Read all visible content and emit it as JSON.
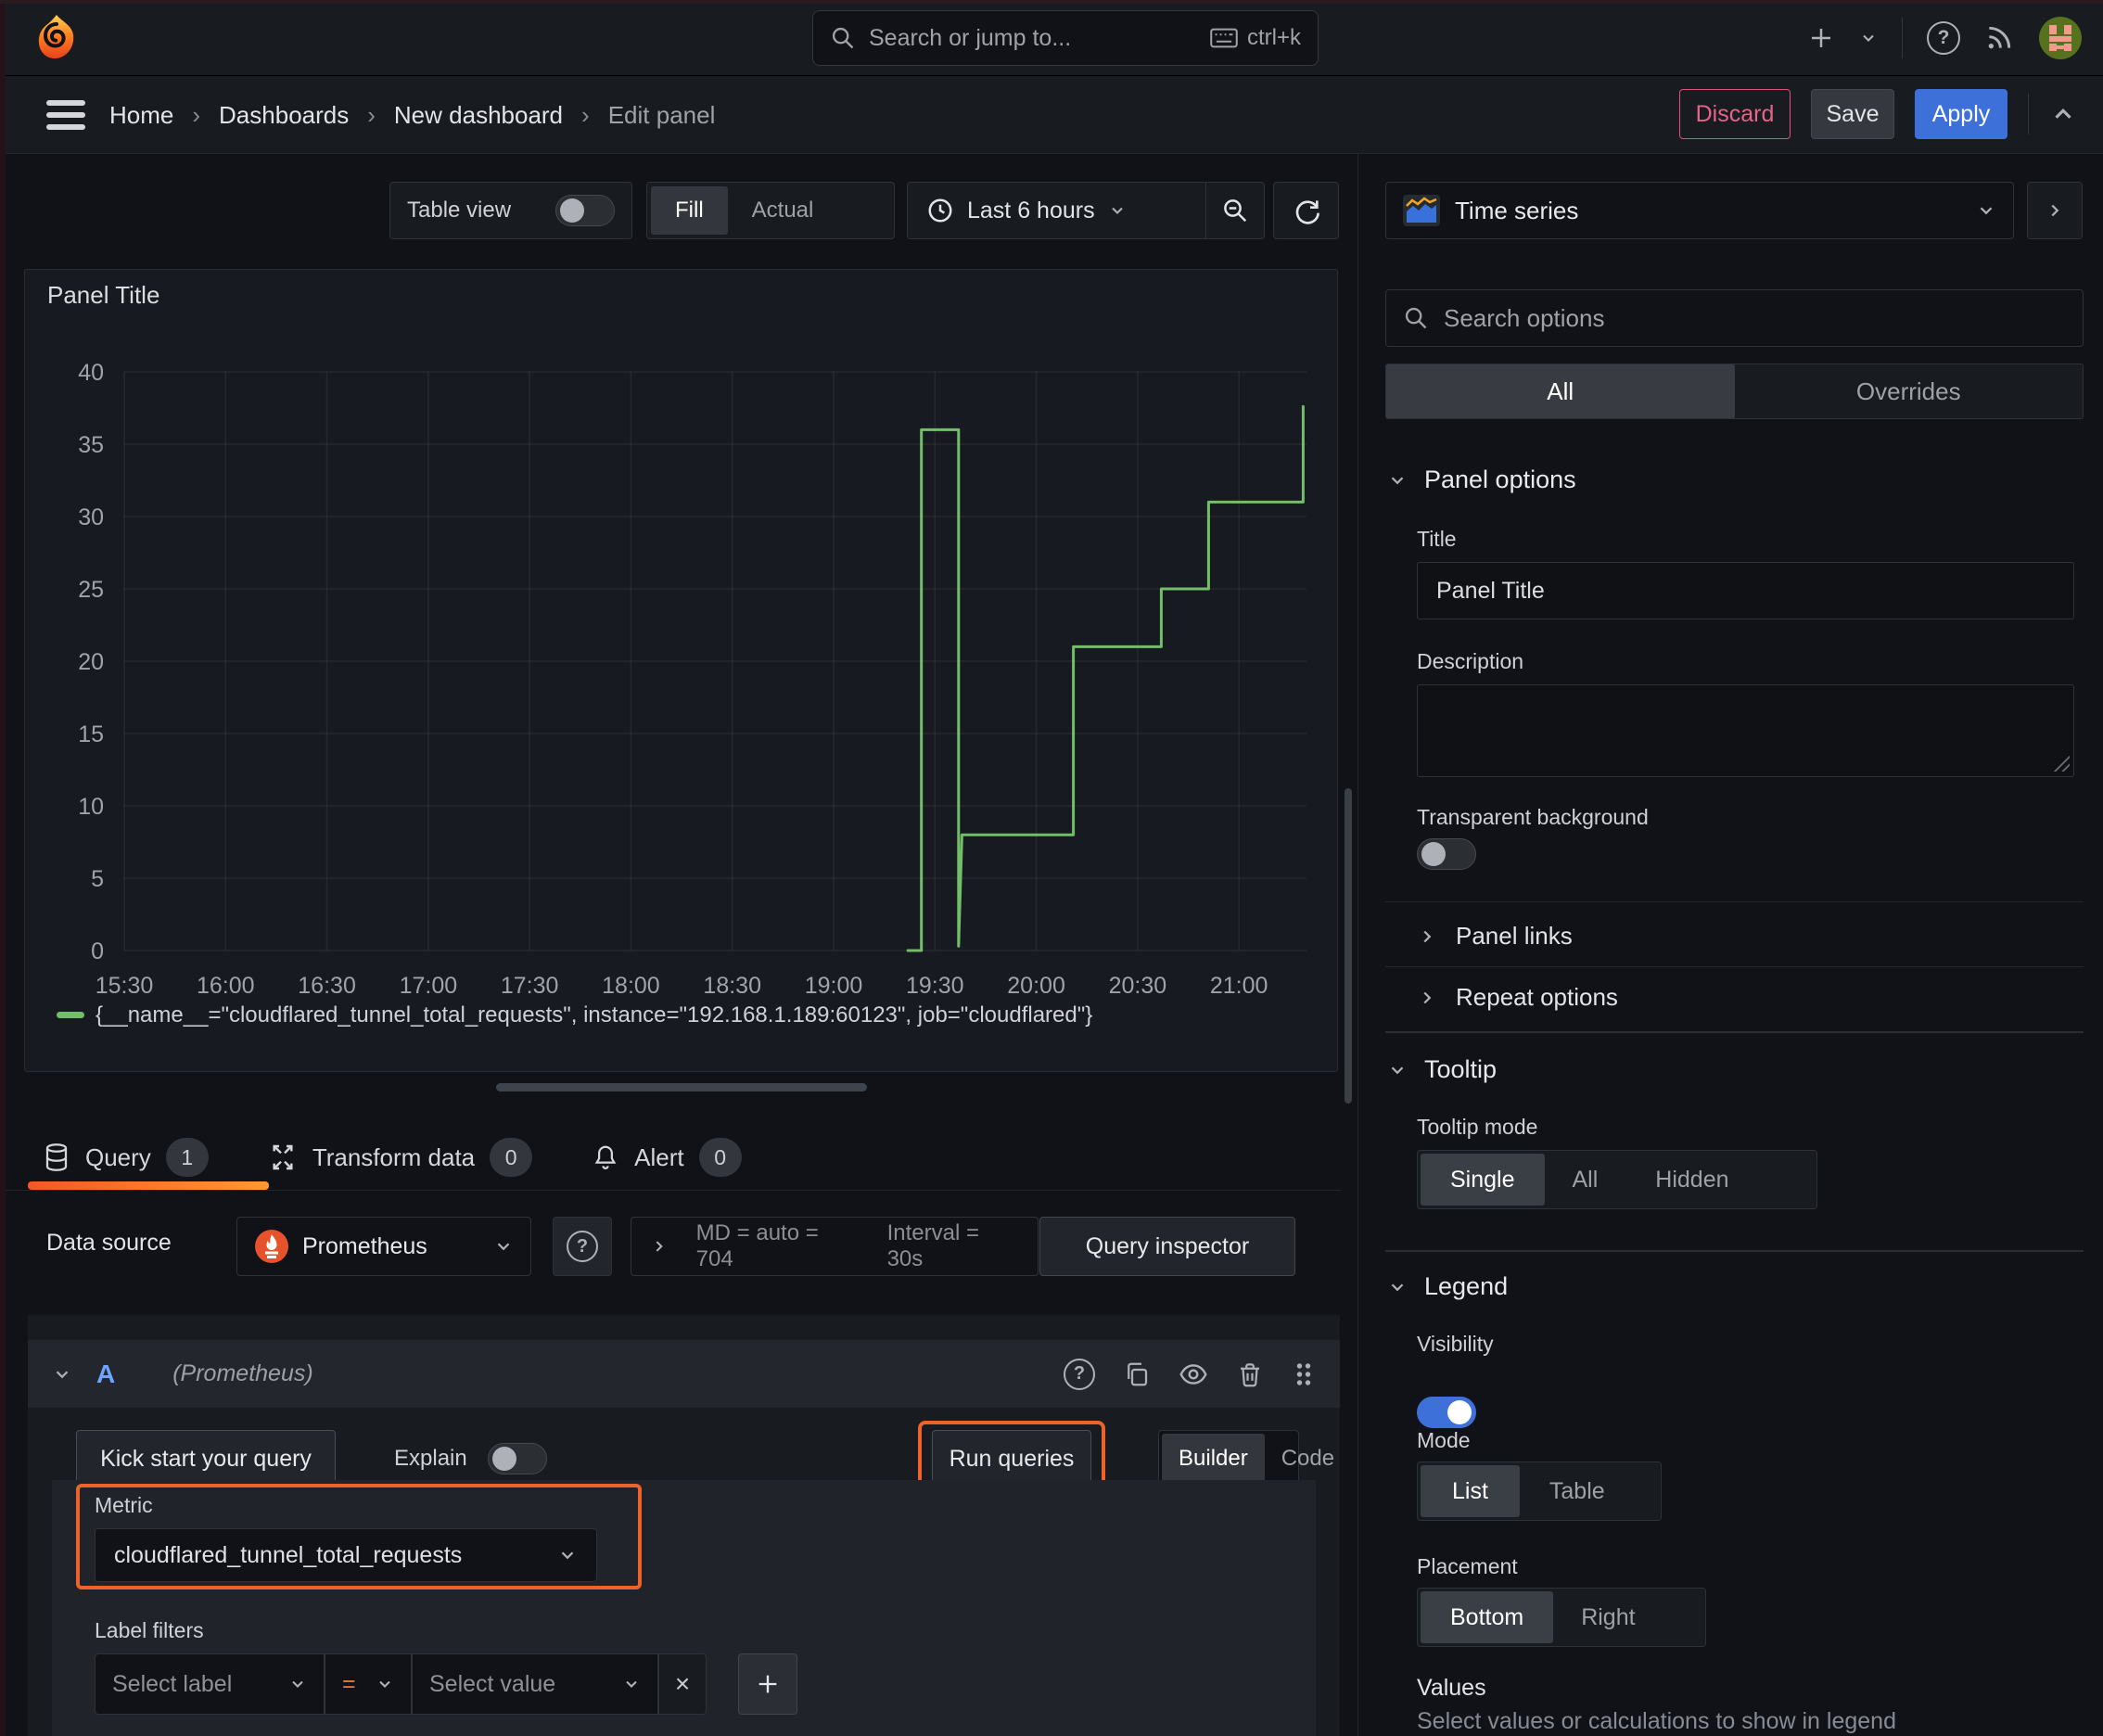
{
  "topnav": {
    "search_placeholder": "Search or jump to...",
    "search_shortcut": "ctrl+k"
  },
  "breadcrumbs": {
    "items": [
      "Home",
      "Dashboards",
      "New dashboard",
      "Edit panel"
    ],
    "separator": "›"
  },
  "header_actions": {
    "discard": "Discard",
    "save": "Save",
    "apply": "Apply"
  },
  "toolbar": {
    "table_view_label": "Table view",
    "view_modes": [
      "Fill",
      "Actual"
    ],
    "time_range_label": "Last 6 hours"
  },
  "panel": {
    "title": "Panel Title"
  },
  "chart_data": {
    "type": "line",
    "title": "Panel Title",
    "x_ticks": [
      "15:30",
      "16:00",
      "16:30",
      "17:00",
      "17:30",
      "18:00",
      "18:30",
      "19:00",
      "19:30",
      "20:00",
      "20:30",
      "21:00"
    ],
    "x_tick_minutes": [
      0,
      30,
      60,
      90,
      120,
      150,
      180,
      210,
      240,
      270,
      300,
      330
    ],
    "x_range_minutes": [
      0,
      350
    ],
    "y_ticks": [
      0,
      5,
      10,
      15,
      20,
      25,
      30,
      35,
      40
    ],
    "ylim": [
      0,
      40
    ],
    "grid": true,
    "legend_position": "bottom",
    "series": [
      {
        "name": "{__name__=\"cloudflared_tunnel_total_requests\", instance=\"192.168.1.189:60123\", job=\"cloudflared\"}",
        "color": "#73BF69",
        "points": [
          [
            232,
            0
          ],
          [
            236,
            0
          ],
          [
            236,
            36
          ],
          [
            247,
            36
          ],
          [
            247,
            0.3
          ],
          [
            248,
            8
          ],
          [
            281,
            8
          ],
          [
            281,
            21
          ],
          [
            307,
            21
          ],
          [
            307,
            25
          ],
          [
            321,
            25
          ],
          [
            321,
            31
          ],
          [
            349,
            31
          ],
          [
            349,
            37.6
          ]
        ]
      }
    ]
  },
  "editor_tabs": [
    {
      "label": "Query",
      "badge": "1"
    },
    {
      "label": "Transform data",
      "badge": "0"
    },
    {
      "label": "Alert",
      "badge": "0"
    }
  ],
  "query_editor": {
    "datasource_label": "Data source",
    "datasource_name": "Prometheus",
    "stat_md": "MD = auto = 704",
    "stat_interval": "Interval = 30s",
    "query_inspector_label": "Query inspector",
    "ref_id": "A",
    "ref_datasource": "(Prometheus)",
    "kick_start_label": "Kick start your query",
    "explain_label": "Explain",
    "run_queries_label": "Run queries",
    "mode_options": [
      "Builder",
      "Code"
    ],
    "metric_label": "Metric",
    "metric_value": "cloudflared_tunnel_total_requests",
    "label_filters_label": "Label filters",
    "select_label_placeholder": "Select label",
    "operator": "=",
    "select_value_placeholder": "Select value"
  },
  "options_pane": {
    "visualization": "Time series",
    "search_placeholder": "Search options",
    "filter_tabs": [
      "All",
      "Overrides"
    ],
    "panel_options": {
      "heading": "Panel options",
      "title_label": "Title",
      "title_value": "Panel Title",
      "description_label": "Description",
      "transparent_bg_label": "Transparent background"
    },
    "panel_links_heading": "Panel links",
    "repeat_options_heading": "Repeat options",
    "tooltip": {
      "heading": "Tooltip",
      "mode_label": "Tooltip mode",
      "modes": [
        "Single",
        "All",
        "Hidden"
      ]
    },
    "legend": {
      "heading": "Legend",
      "visibility_label": "Visibility",
      "mode_label": "Mode",
      "modes": [
        "List",
        "Table"
      ],
      "placement_label": "Placement",
      "placements": [
        "Bottom",
        "Right"
      ],
      "values_label": "Values",
      "values_hint": "Select values or calculations to show in legend"
    }
  },
  "icons": {
    "question_glyph": "?",
    "close_glyph": "×"
  },
  "colors": {
    "highlight_orange": "#ee6329",
    "series_green": "#73BF69",
    "primary_blue": "#3d71d9",
    "danger_pink": "#e0507a",
    "background": "#111217",
    "surface": "#181b1f"
  }
}
